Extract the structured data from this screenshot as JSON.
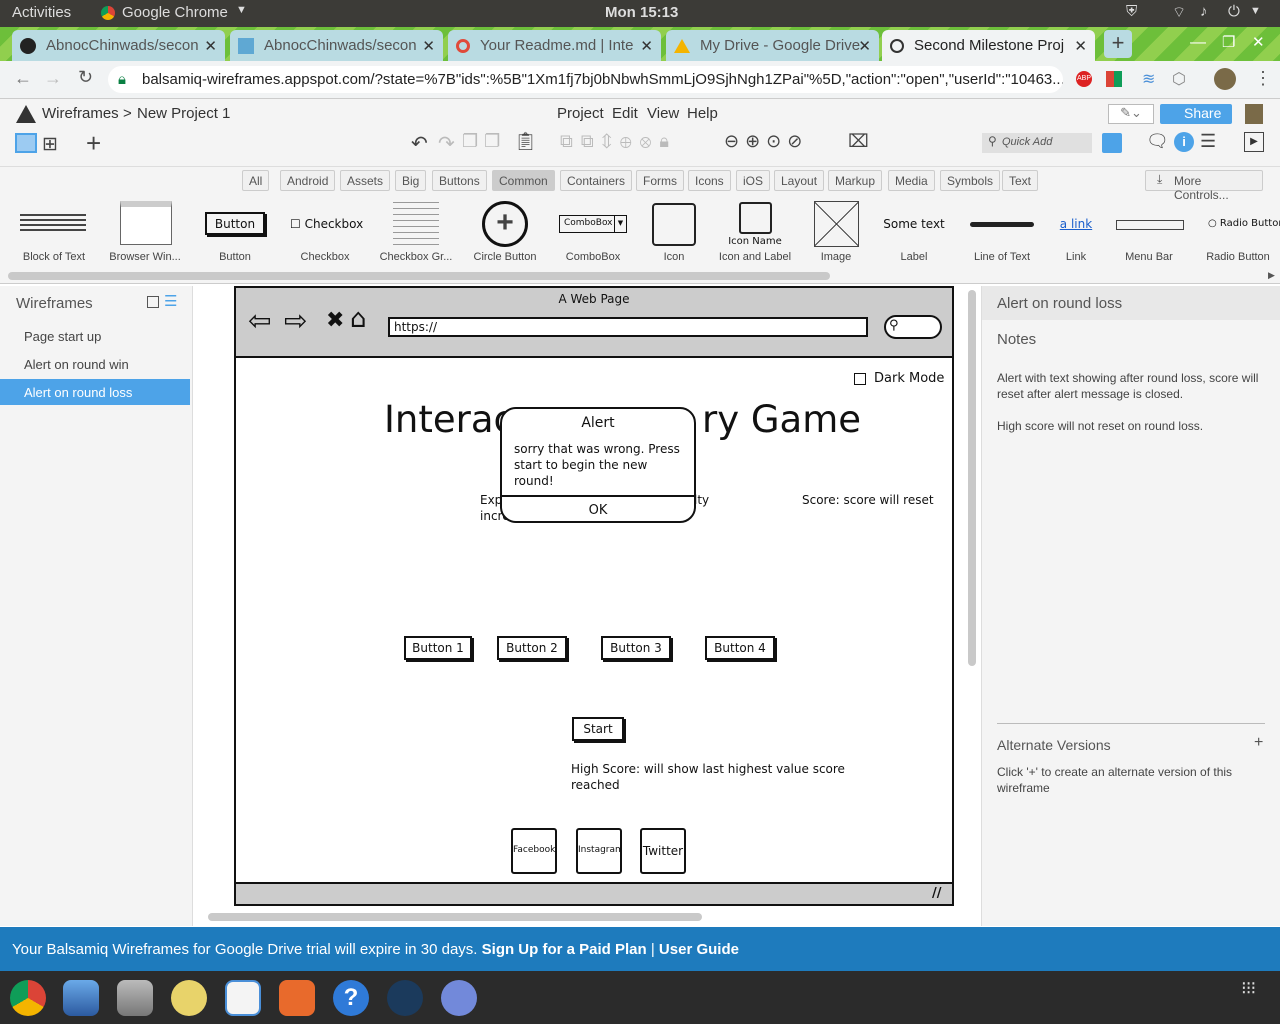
{
  "system": {
    "activities": "Activities",
    "app_name": "Google Chrome",
    "clock": "Mon 15:13"
  },
  "tabs": [
    {
      "label": "AbnocChinwads/secon"
    },
    {
      "label": "AbnocChinwads/secon"
    },
    {
      "label": "Your Readme.md | Inte"
    },
    {
      "label": "My Drive - Google Drive"
    },
    {
      "label": "Second Milestone Proj"
    }
  ],
  "address": {
    "url": "balsamiq-wireframes.appspot.com/?state=%7B\"ids\":%5B\"1Xm1fj7bj0bNbwhSmmLjO9SjhNgh1ZPai\"%5D,\"action\":\"open\",\"userId\":\"10463..."
  },
  "app": {
    "breadcrumb_root": "Wireframes",
    "breadcrumb_sep": ">",
    "project": "New Project 1",
    "menus": [
      "Project",
      "Edit",
      "View",
      "Help"
    ],
    "share": "Share",
    "quick_add": "Quick Add"
  },
  "library": {
    "categories": [
      "All",
      "Android",
      "Assets",
      "Big",
      "Buttons",
      "Common",
      "Containers",
      "Forms",
      "Icons",
      "iOS",
      "Layout",
      "Markup",
      "Media",
      "Symbols",
      "Text"
    ],
    "selected": "Common",
    "more_controls": "More Controls...",
    "components": [
      "Block of Text",
      "Browser Win...",
      "Button",
      "Checkbox",
      "Checkbox Gr...",
      "Circle Button",
      "ComboBox",
      "Icon",
      "Icon and Label",
      "Image",
      "Label",
      "Line of Text",
      "Link",
      "Menu Bar",
      "Radio Button"
    ],
    "previews": {
      "button": "Button",
      "checkbox": "Checkbox",
      "combobox": "ComboBox",
      "icon_name": "Icon Name",
      "some_text": "Some text",
      "link": "a link",
      "radio": "Radio Button"
    }
  },
  "left_panel": {
    "title": "Wireframes",
    "items": [
      "Page start up",
      "Alert on round win",
      "Alert on round loss"
    ],
    "selected_index": 2
  },
  "wireframe": {
    "page_title": "A Web Page",
    "url": "https://",
    "dark_mode": "Dark Mode",
    "heading_left": "Interac",
    "heading_right": "ry Game",
    "alert_title": "Alert",
    "alert_text": "sorry that was wrong. Press start to begin the new round!",
    "alert_ok": "OK",
    "exp_text_a": "Exp",
    "exp_text_b": "incre",
    "lty_text": "lty",
    "score": "Score: score will reset",
    "buttons": [
      "Button 1",
      "Button 2",
      "Button 3",
      "Button 4"
    ],
    "start": "Start",
    "high_score": "High Score: will show last highest value score reached",
    "social": [
      "Facebook",
      "Instagram",
      "Twitter"
    ]
  },
  "right_panel": {
    "title": "Alert on round loss",
    "notes_label": "Notes",
    "notes_1": "Alert with text showing after round loss, score will reset after alert message is closed.",
    "notes_2": "High score will not reset on round loss.",
    "alt_title": "Alternate Versions",
    "alt_add": "+",
    "alt_hint": "Click '+' to create an alternate version of this wireframe"
  },
  "trial": {
    "text": "Your Balsamiq Wireframes for Google Drive trial will expire in 30 days.",
    "signup": "Sign Up for a Paid Plan",
    "sep": "|",
    "guide": "User Guide"
  }
}
